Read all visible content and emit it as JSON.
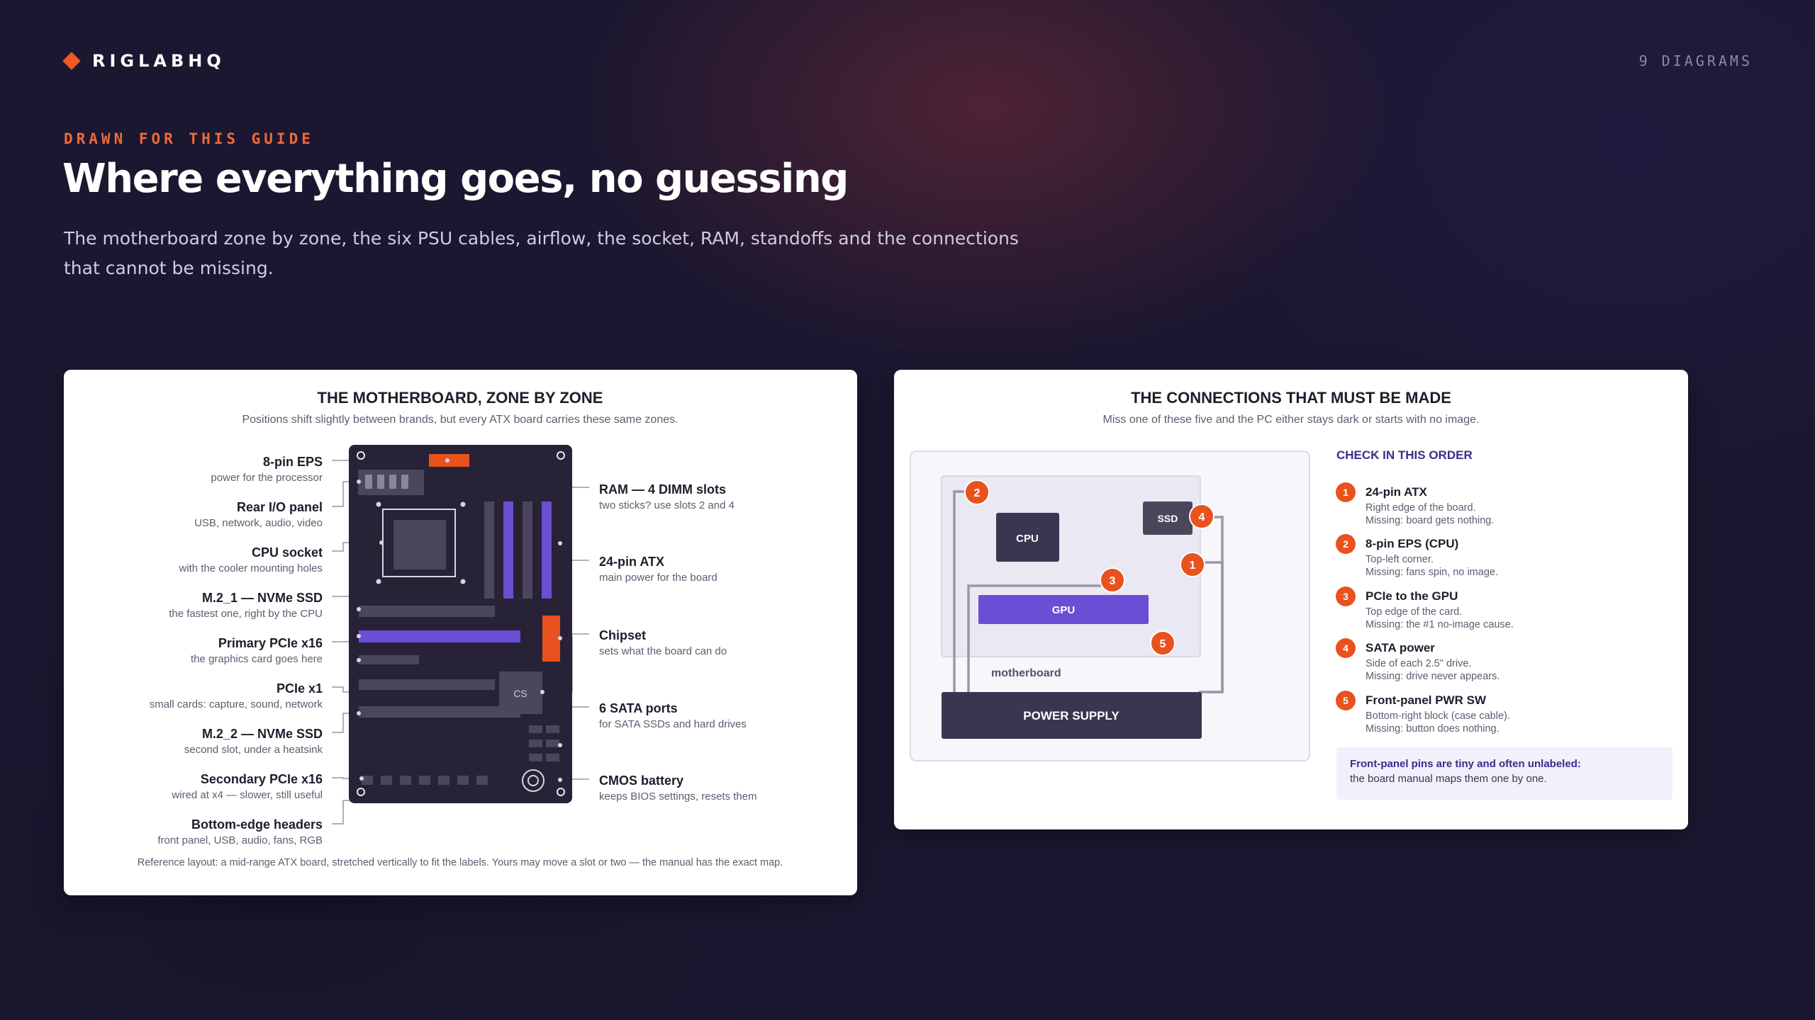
{
  "brand": {
    "name": "RIGLABHQ",
    "icon": "diamond-logo-icon",
    "accent": "#ef5a24"
  },
  "header": {
    "count": "9 DIAGRAMS"
  },
  "hero": {
    "eyebrow": "DRAWN FOR THIS GUIDE",
    "title": "Where everything goes, no guessing",
    "subtitle": "The motherboard zone by zone, the six PSU cables, airflow, the socket, RAM, standoffs and the connections that cannot be missing."
  },
  "motherboard": {
    "title": "THE MOTHERBOARD, ZONE BY ZONE",
    "subtitle": "Positions shift slightly between brands, but every ATX board carries these same zones.",
    "cs_label": "CS",
    "left_labels": [
      {
        "title": "8-pin EPS",
        "desc": "power for the processor"
      },
      {
        "title": "Rear I/O panel",
        "desc": "USB, network, audio, video"
      },
      {
        "title": "CPU socket",
        "desc": "with the cooler mounting holes"
      },
      {
        "title": "M.2_1 — NVMe SSD",
        "desc": "the fastest one, right by the CPU"
      },
      {
        "title": "Primary PCIe x16",
        "desc": "the graphics card goes here"
      },
      {
        "title": "PCIe x1",
        "desc": "small cards: capture, sound, network"
      },
      {
        "title": "M.2_2 — NVMe SSD",
        "desc": "second slot, under a heatsink"
      },
      {
        "title": "Secondary PCIe x16",
        "desc": "wired at x4 — slower, still useful"
      },
      {
        "title": "Bottom-edge headers",
        "desc": "front panel, USB, audio, fans, RGB"
      }
    ],
    "right_labels": [
      {
        "title": "RAM — 4 DIMM slots",
        "desc": "two sticks? use slots 2 and 4"
      },
      {
        "title": "24-pin ATX",
        "desc": "main power for the board"
      },
      {
        "title": "Chipset",
        "desc": "sets what the board can do"
      },
      {
        "title": "6 SATA ports",
        "desc": "for SATA SSDs and hard drives"
      },
      {
        "title": "CMOS battery",
        "desc": "keeps BIOS settings, resets them"
      }
    ],
    "footnote": "Reference layout: a mid-range ATX board, stretched vertically to fit the labels. Yours may move a slot or two — the manual has the exact map."
  },
  "connections": {
    "title": "THE CONNECTIONS THAT MUST BE MADE",
    "subtitle": "Miss one of these five and the PC either stays dark or starts with no image.",
    "diagram": {
      "cpu": "CPU",
      "ssd": "SSD",
      "gpu": "GPU",
      "board": "motherboard",
      "psu": "POWER SUPPLY"
    },
    "check_title": "CHECK IN THIS ORDER",
    "steps": [
      {
        "num": "1",
        "title": "24-pin ATX",
        "line1": "Right edge of the board.",
        "line2": "Missing: board gets nothing."
      },
      {
        "num": "2",
        "title": "8-pin EPS (CPU)",
        "line1": "Top-left corner.",
        "line2": "Missing: fans spin, no image."
      },
      {
        "num": "3",
        "title": "PCIe to the GPU",
        "line1": "Top edge of the card.",
        "line2": "Missing: the #1 no-image cause."
      },
      {
        "num": "4",
        "title": "SATA power",
        "line1": "Side of each 2.5\" drive.",
        "line2": "Missing: drive never appears."
      },
      {
        "num": "5",
        "title": "Front-panel PWR SW",
        "line1": "Bottom-right block (case cable).",
        "line2": "Missing: button does nothing."
      }
    ],
    "note_bold": "Front-panel pins are tiny and often unlabeled:",
    "note_text": "the board manual maps them one by one."
  },
  "colors": {
    "orange": "#e8521f",
    "purple": "#6a4fd6",
    "board": "#272236",
    "note_bg": "#f2f0fb",
    "heading": "#3a2d8a"
  }
}
